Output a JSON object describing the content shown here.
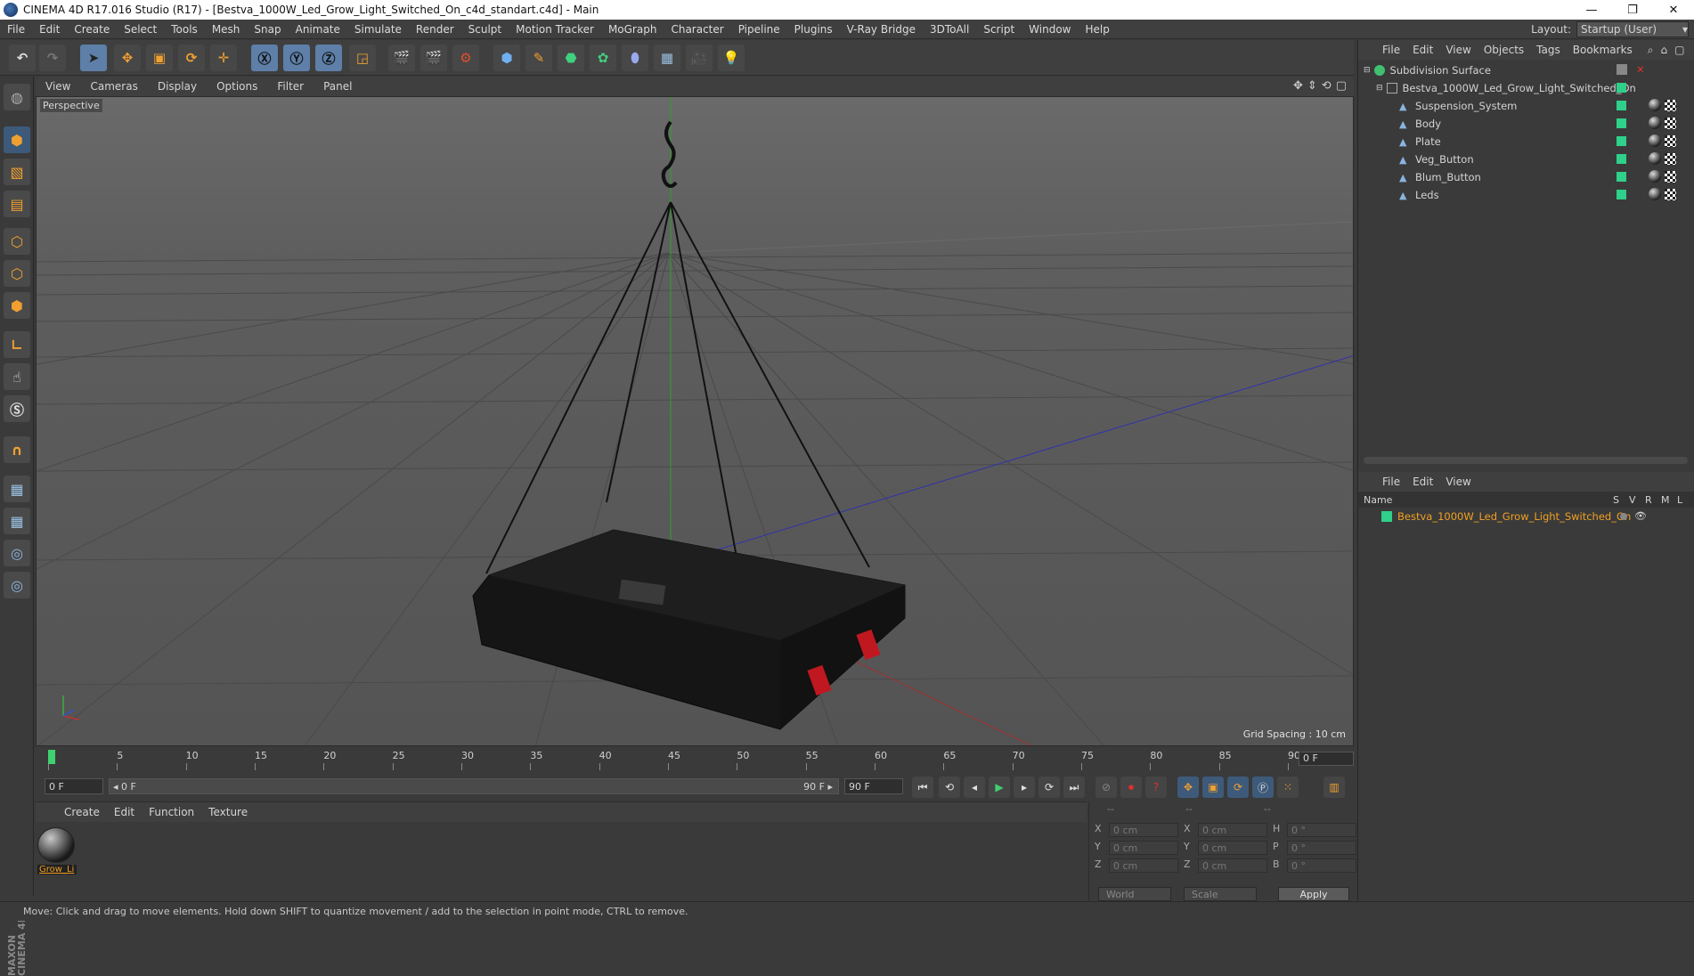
{
  "window": {
    "title": "CINEMA 4D R17.016 Studio (R17) - [Bestva_1000W_Led_Grow_Light_Switched_On_c4d_standart.c4d] - Main",
    "minimize": "—",
    "restore": "❐",
    "close": "✕"
  },
  "menu": [
    "File",
    "Edit",
    "Create",
    "Select",
    "Tools",
    "Mesh",
    "Snap",
    "Animate",
    "Simulate",
    "Render",
    "Sculpt",
    "Motion Tracker",
    "MoGraph",
    "Character",
    "Pipeline",
    "Plugins",
    "V-Ray Bridge",
    "3DToAll",
    "Script",
    "Window",
    "Help"
  ],
  "layout": {
    "label": "Layout:",
    "value": "Startup (User)"
  },
  "viewport": {
    "menu": [
      "View",
      "Cameras",
      "Display",
      "Options",
      "Filter",
      "Panel"
    ],
    "label": "Perspective",
    "grid_spacing": "Grid Spacing : 10 cm"
  },
  "timeline": {
    "ticks": [
      "0",
      "5",
      "10",
      "15",
      "20",
      "25",
      "30",
      "35",
      "40",
      "45",
      "50",
      "55",
      "60",
      "65",
      "70",
      "75",
      "80",
      "85",
      "90"
    ],
    "current_frame": "0 F"
  },
  "playback": {
    "start": "0 F",
    "range_start": "◂ 0 F",
    "range_end": "90 F ▸",
    "end": "90 F"
  },
  "materials": {
    "menu": [
      "Create",
      "Edit",
      "Function",
      "Texture"
    ],
    "items": [
      {
        "name": "Grow_Li"
      }
    ]
  },
  "coords": {
    "header": [
      "--",
      "--",
      "--"
    ],
    "rows": [
      {
        "a": "X",
        "av": "0 cm",
        "b": "X",
        "bv": "0 cm",
        "c": "H",
        "cv": "0 °"
      },
      {
        "a": "Y",
        "av": "0 cm",
        "b": "Y",
        "bv": "0 cm",
        "c": "P",
        "cv": "0 °"
      },
      {
        "a": "Z",
        "av": "0 cm",
        "b": "Z",
        "bv": "0 cm",
        "c": "B",
        "cv": "0 °"
      }
    ],
    "space": "World",
    "mode": "Scale",
    "apply": "Apply"
  },
  "objects": {
    "menu": [
      "File",
      "Edit",
      "View",
      "Objects",
      "Tags",
      "Bookmarks"
    ],
    "tree": [
      {
        "name": "Subdivision Surface"
      },
      {
        "name": "Bestva_1000W_Led_Grow_Light_Switched_On"
      },
      {
        "name": "Suspension_System"
      },
      {
        "name": "Body"
      },
      {
        "name": "Plate"
      },
      {
        "name": "Veg_Button"
      },
      {
        "name": "Blum_Button"
      },
      {
        "name": "Leds"
      }
    ]
  },
  "layers": {
    "menu": [
      "File",
      "Edit",
      "View"
    ],
    "columns": {
      "name": "Name",
      "s": "S",
      "v": "V",
      "r": "R",
      "m": "M",
      "l": "L"
    },
    "items": [
      {
        "name": "Bestva_1000W_Led_Grow_Light_Switched_On"
      }
    ]
  },
  "status": "Move: Click and drag to move elements. Hold down SHIFT to quantize movement / add to the selection in point mode, CTRL to remove.",
  "branding": "MAXON CINEMA 4D",
  "colors": {
    "accent": "#f0a030",
    "selected": "#5d7fa8",
    "layer_green": "#2fd08a",
    "layer_text": "#f0a020"
  }
}
